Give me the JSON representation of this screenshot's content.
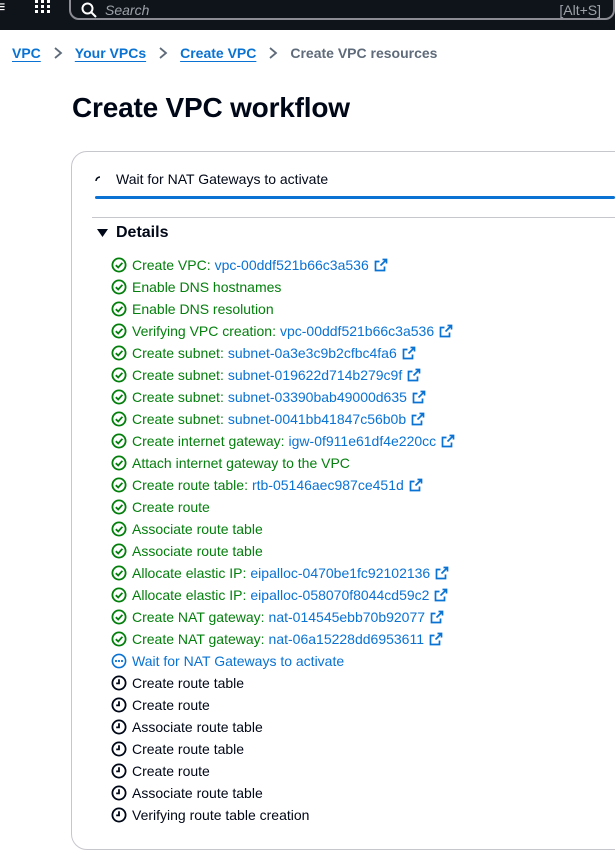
{
  "topnav": {
    "menu_glyph": "≡",
    "search_placeholder": "Search",
    "search_shortcut": "[Alt+S]"
  },
  "breadcrumb": {
    "items": [
      "VPC",
      "Your VPCs",
      "Create VPC"
    ],
    "current": "Create VPC resources"
  },
  "page": {
    "title": "Create VPC workflow"
  },
  "progress": {
    "label": "Wait for NAT Gateways to activate"
  },
  "details": {
    "header": "Details",
    "steps": [
      {
        "status": "success",
        "text": "Create VPC:",
        "resource": "vpc-00ddf521b66c3a536"
      },
      {
        "status": "success",
        "text": "Enable DNS hostnames",
        "resource": ""
      },
      {
        "status": "success",
        "text": "Enable DNS resolution",
        "resource": ""
      },
      {
        "status": "success",
        "text": "Verifying VPC creation:",
        "resource": "vpc-00ddf521b66c3a536"
      },
      {
        "status": "success",
        "text": "Create subnet:",
        "resource": "subnet-0a3e3c9b2cfbc4fa6"
      },
      {
        "status": "success",
        "text": "Create subnet:",
        "resource": "subnet-019622d714b279c9f"
      },
      {
        "status": "success",
        "text": "Create subnet:",
        "resource": "subnet-03390bab49000d635"
      },
      {
        "status": "success",
        "text": "Create subnet:",
        "resource": "subnet-0041bb41847c56b0b"
      },
      {
        "status": "success",
        "text": "Create internet gateway:",
        "resource": "igw-0f911e61df4e220cc"
      },
      {
        "status": "success",
        "text": "Attach internet gateway to the VPC",
        "resource": ""
      },
      {
        "status": "success",
        "text": "Create route table:",
        "resource": "rtb-05146aec987ce451d"
      },
      {
        "status": "success",
        "text": "Create route",
        "resource": ""
      },
      {
        "status": "success",
        "text": "Associate route table",
        "resource": ""
      },
      {
        "status": "success",
        "text": "Associate route table",
        "resource": ""
      },
      {
        "status": "success",
        "text": "Allocate elastic IP:",
        "resource": "eipalloc-0470be1fc92102136"
      },
      {
        "status": "success",
        "text": "Allocate elastic IP:",
        "resource": "eipalloc-058070f8044cd59c2"
      },
      {
        "status": "success",
        "text": "Create NAT gateway:",
        "resource": "nat-014545ebb70b92077"
      },
      {
        "status": "success",
        "text": "Create NAT gateway:",
        "resource": "nat-06a15228dd6953611"
      },
      {
        "status": "inprogress",
        "text": "Wait for NAT Gateways to activate",
        "resource": ""
      },
      {
        "status": "pending",
        "text": "Create route table",
        "resource": ""
      },
      {
        "status": "pending",
        "text": "Create route",
        "resource": ""
      },
      {
        "status": "pending",
        "text": "Associate route table",
        "resource": ""
      },
      {
        "status": "pending",
        "text": "Create route table",
        "resource": ""
      },
      {
        "status": "pending",
        "text": "Create route",
        "resource": ""
      },
      {
        "status": "pending",
        "text": "Associate route table",
        "resource": ""
      },
      {
        "status": "pending",
        "text": "Verifying route table creation",
        "resource": ""
      }
    ]
  },
  "colors": {
    "success": "#037f0c",
    "in_progress": "#0972d3",
    "link": "#0972d3",
    "nav_bg": "#0f141a"
  },
  "icons": {
    "success": "status-success-icon",
    "inprogress": "status-in-progress-icon",
    "pending": "status-pending-icon",
    "external": "external-link-icon"
  }
}
